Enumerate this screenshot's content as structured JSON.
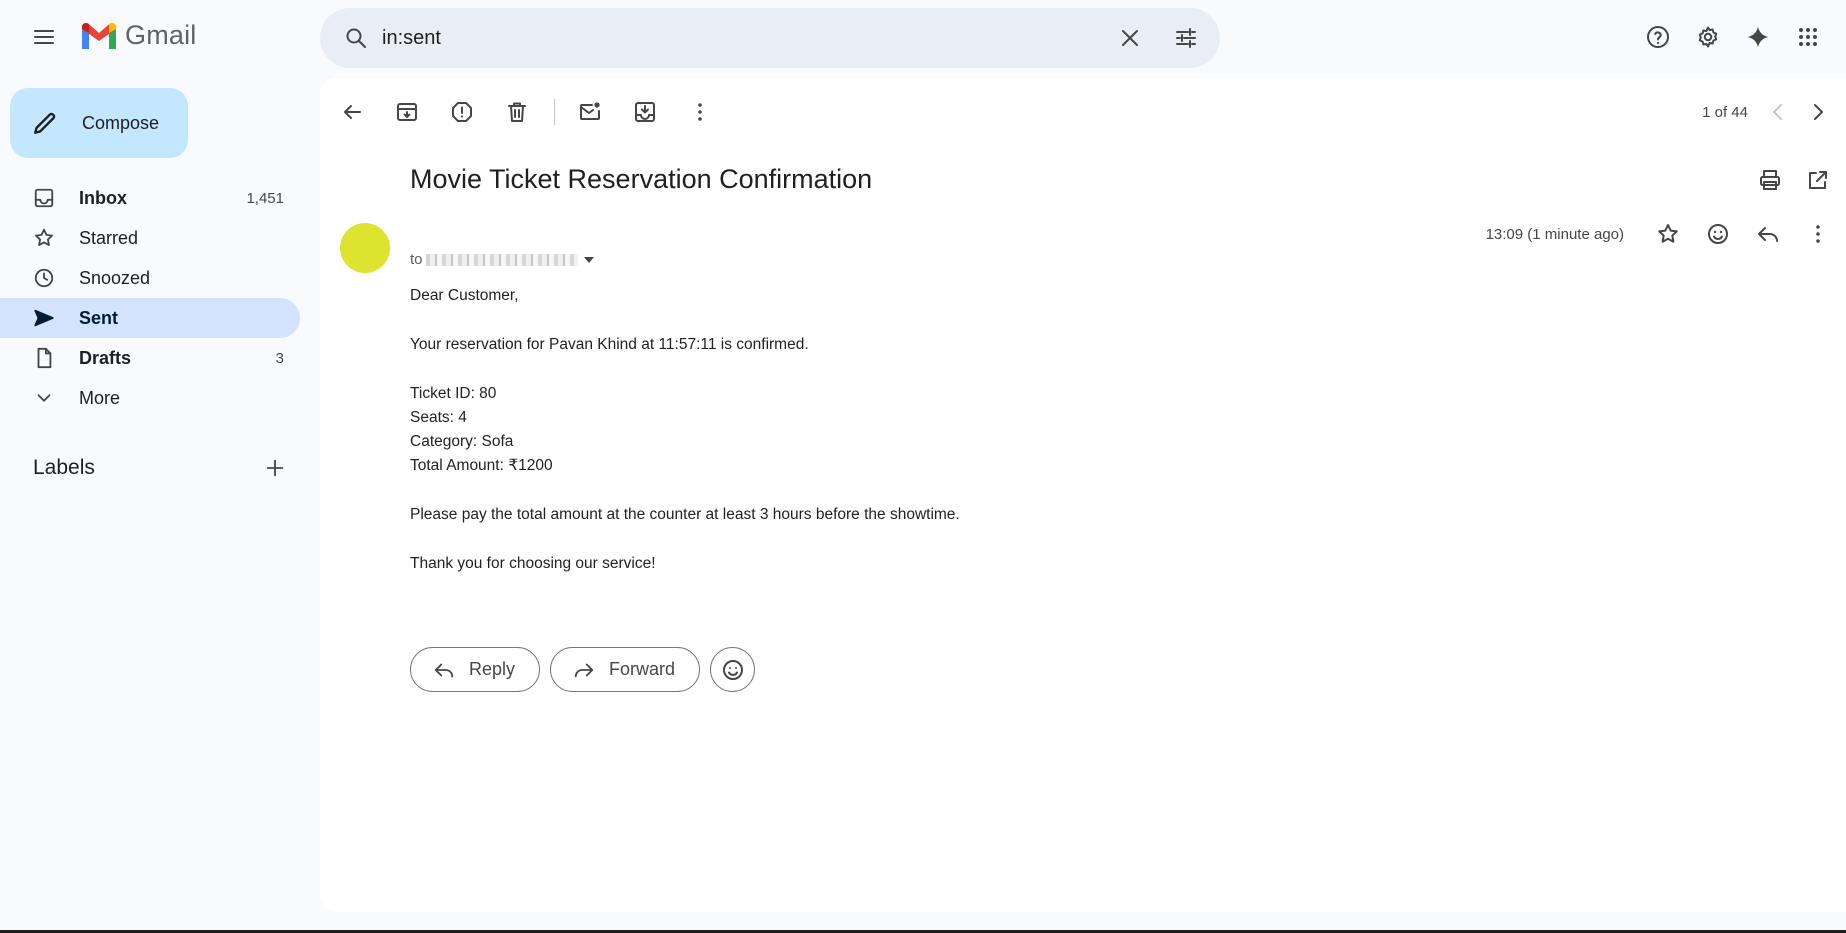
{
  "header": {
    "app_name": "Gmail",
    "search_value": "in:sent",
    "search_placeholder": "Search mail"
  },
  "sidebar": {
    "compose_label": "Compose",
    "items": [
      {
        "label": "Inbox",
        "count": "1,451",
        "icon": "inbox-icon"
      },
      {
        "label": "Starred",
        "count": "",
        "icon": "star-icon"
      },
      {
        "label": "Snoozed",
        "count": "",
        "icon": "clock-icon"
      },
      {
        "label": "Sent",
        "count": "",
        "icon": "send-icon"
      },
      {
        "label": "Drafts",
        "count": "3",
        "icon": "draft-icon"
      },
      {
        "label": "More",
        "count": "",
        "icon": "chevron-down-icon"
      }
    ],
    "labels_title": "Labels"
  },
  "toolbar": {
    "pager_text": "1 of 44"
  },
  "email": {
    "subject": "Movie Ticket Reservation Confirmation",
    "to_prefix": "to",
    "time": "13:09 (1 minute ago)",
    "body": {
      "greeting": "Dear Customer,",
      "line1": "Your reservation for Pavan Khind at 11:57:11 is confirmed.",
      "ticket_id": "Ticket ID: 80",
      "seats": "Seats: 4",
      "category": "Category: Sofa",
      "total": "Total Amount: ₹1200",
      "line2": "Please pay the total amount at the counter at least 3 hours before the showtime.",
      "closing": "Thank you for choosing our service!"
    }
  },
  "actions": {
    "reply_label": "Reply",
    "forward_label": "Forward"
  },
  "colors": {
    "compose_bg": "#c2e7ff",
    "active_nav": "#d3e3fd",
    "avatar": "#dde32e",
    "page_bg": "#f8fafd"
  }
}
